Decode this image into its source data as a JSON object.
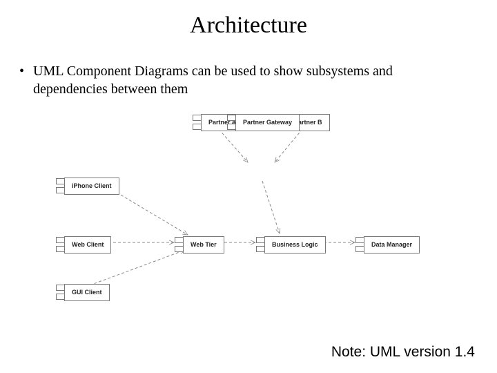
{
  "title": "Architecture",
  "bullet": "UML Component Diagrams can be used to show subsystems and dependencies between them",
  "note": "Note: UML version 1.4",
  "components": {
    "partner_a": "Partner A",
    "partner_b": "Partner B",
    "partner_gateway": "Partner Gateway",
    "iphone_client": "iPhone Client",
    "web_client": "Web Client",
    "web_tier": "Web Tier",
    "business_logic": "Business Logic",
    "data_manager": "Data Manager",
    "gui_client": "GUI Client"
  },
  "dependencies": [
    {
      "from": "partner_a",
      "to": "partner_gateway"
    },
    {
      "from": "partner_b",
      "to": "partner_gateway"
    },
    {
      "from": "partner_gateway",
      "to": "business_logic"
    },
    {
      "from": "iphone_client",
      "to": "web_tier"
    },
    {
      "from": "web_client",
      "to": "web_tier"
    },
    {
      "from": "gui_client",
      "to": "web_tier"
    },
    {
      "from": "web_tier",
      "to": "business_logic"
    },
    {
      "from": "business_logic",
      "to": "data_manager"
    }
  ]
}
